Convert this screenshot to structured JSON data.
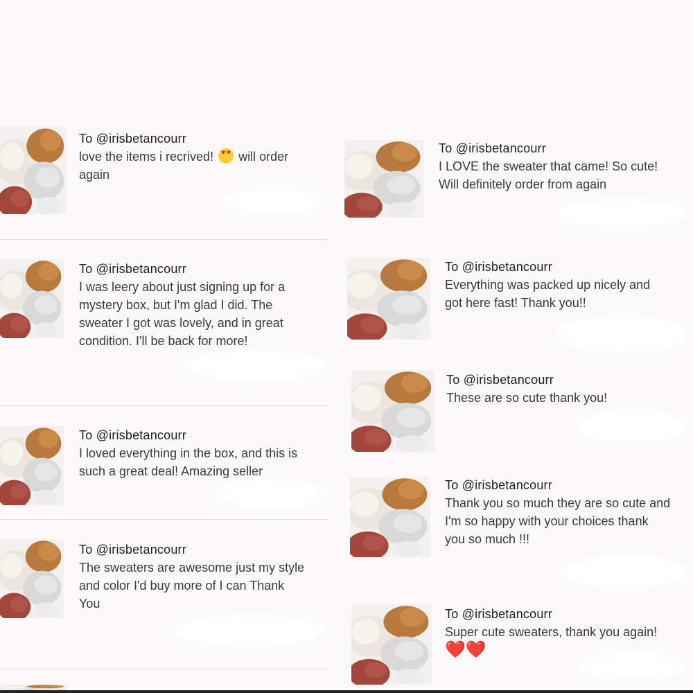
{
  "recipient": "To @irisbetancourr",
  "colors": {
    "background": "#fbf9fa",
    "heart": "#e0191e"
  },
  "left_reviews": [
    {
      "to": "To @irisbetancourr",
      "lines": [
        "love the items i recrived!",
        "again"
      ],
      "inline_emoji_after": "will order",
      "emoji": "smiling-face-heart-eyes"
    },
    {
      "to": "To @irisbetancourr",
      "lines": [
        "I was leery about just signing up for a",
        "mystery box, but I'm glad I did. The",
        "sweater I got was lovely, and in great",
        "condition. I'll be back for more!"
      ]
    },
    {
      "to": "To @irisbetancourr",
      "lines": [
        "I loved everything in the box, and this is",
        "such a great deal! Amazing seller"
      ]
    },
    {
      "to": "To @irisbetancourr",
      "lines": [
        "The sweaters are awesome just my style",
        "and color I'd buy more of I can Thank",
        "You"
      ]
    }
  ],
  "right_reviews": [
    {
      "to": "To @irisbetancourr",
      "lines": [
        "I LOVE the sweater that came! So cute!",
        "Will definitely order from again"
      ]
    },
    {
      "to": "To @irisbetancourr",
      "lines": [
        "Everything was packed up nicely and",
        "got here fast! Thank you!!"
      ]
    },
    {
      "to": "To @irisbetancourr",
      "lines": [
        "These are so cute thank you!"
      ]
    },
    {
      "to": "To @irisbetancourr",
      "lines": [
        "Thank you so much they are so cute and",
        "I'm so happy with your choices thank",
        "you so much !!!"
      ]
    },
    {
      "to": "To @irisbetancourr",
      "lines": [
        "Super cute sweaters, thank you again!"
      ],
      "hearts": "❤️❤️"
    }
  ]
}
